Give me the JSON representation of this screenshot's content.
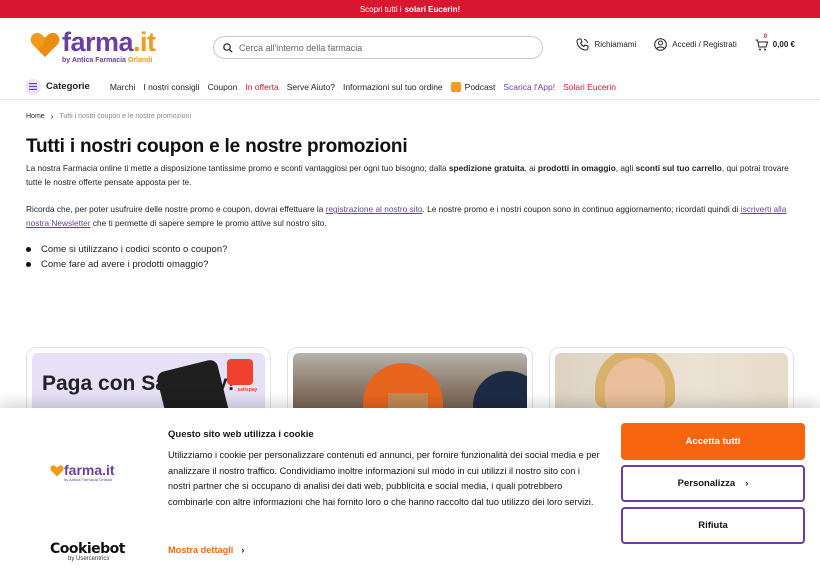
{
  "topbar": {
    "text": "Scopri tutti i",
    "bold": "solari Eucerin!"
  },
  "logo": {
    "main": "farma",
    "dot": ".it",
    "sub_prefix": "by Antica Farmacia",
    "sub_name": "Orlandi"
  },
  "search": {
    "placeholder": "Cerca all'interno della farmacia"
  },
  "header_actions": {
    "call": "Richiamami",
    "login": "Accedi / Registrati",
    "cart_count": "0",
    "cart_total": "0,00 €"
  },
  "nav": {
    "categories": "Categorie",
    "items": [
      "Marchi",
      "I nostri consigli",
      "Coupon",
      "In offerta",
      "Serve Aiuto?",
      "Informazioni sul tuo ordine",
      "Podcast",
      "Scarica l'App!",
      "Solari Eucerin"
    ]
  },
  "breadcrumb": {
    "home": "Home",
    "current": "Tutti i nostri coupon e le nostre promozioni"
  },
  "page": {
    "title": "Tutti i nostri coupon e le nostre promozioni",
    "p1_a": "La nostra Farmacia online ti mette a disposizione tantissime promo e sconti vantaggiosi per ogni tuo bisogno; dalla ",
    "p1_b1": "spedizione gratuita",
    "p1_c": ", ai ",
    "p1_b2": "prodotti in omaggio",
    "p1_d": ", agli ",
    "p1_b3": "sconti sul tuo carrello",
    "p1_e": ", qui potrai trovare tutte le nostre offerte pensate apposta per te.",
    "p2_a": "Ricorda che, per poter usufruire delle nostre promo e coupon, dovrai effettuare la ",
    "p2_link1": "registrazione al nostro sito",
    "p2_b": ". Le nostre promo e i nostri coupon sono in continuo aggiornamento; ricordati quindi di ",
    "p2_link2": "iscriverti alla nostra Newsletter",
    "p2_c": " che ti permette di sapere sempre le promo attive sul nostro sito.",
    "bullets": [
      "Come si utilizzano i codici sconto o coupon?",
      "Come fare ad avere i prodotti omaggio?"
    ]
  },
  "cards": {
    "card1_text": "Paga con Satispay!",
    "card1_brand": "satispay"
  },
  "cookie": {
    "title": "Questo sito web utilizza i cookie",
    "body": "Utilizziamo i cookie per personalizzare contenuti ed annunci, per fornire funzionalità dei social media e per analizzare il nostro traffico. Condividiamo inoltre informazioni sul modo in cui utilizzi il nostro sito con i nostri partner che si occupano di analisi dei dati web, pubblicità e social media, i quali potrebbero combinarle con altre informazioni che hai fornito loro o che hanno raccolto dal tuo utilizzo dei loro servizi.",
    "more": "Mostra dettagli",
    "accept": "Accetta tutti",
    "customize": "Personalizza",
    "reject": "Rifiuta",
    "cookiebot": "Cookiebot",
    "usercentrics": "by Usercentrics",
    "logo_main": "farma.it",
    "logo_sub": "by Antica Farmacia Orlandi"
  },
  "colors": {
    "brand_purple": "#6b3fa0",
    "brand_orange": "#f29a1a",
    "topbar_red": "#d9162f",
    "accept_orange": "#f7650e"
  }
}
